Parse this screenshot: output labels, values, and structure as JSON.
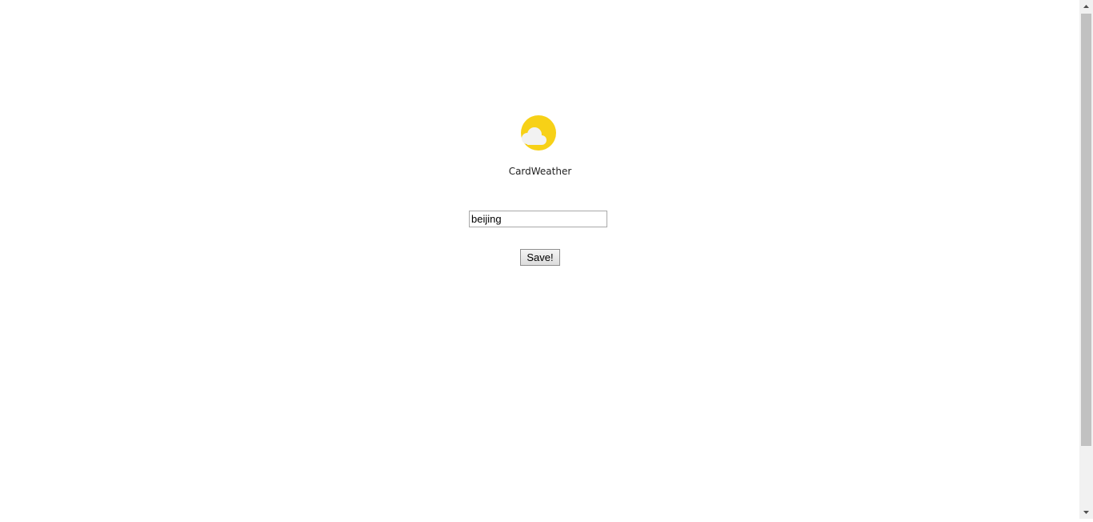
{
  "app": {
    "name": "CardWeather",
    "logo_icon": "sun-behind-cloud-icon",
    "colors": {
      "sun": "#f7d117",
      "cloud": "#f2f2f2"
    }
  },
  "form": {
    "city_value": "beijing",
    "save_label": "Save!"
  },
  "scrollbar": {
    "up_icon": "scroll-up-arrow-icon",
    "down_icon": "scroll-down-arrow-icon"
  }
}
